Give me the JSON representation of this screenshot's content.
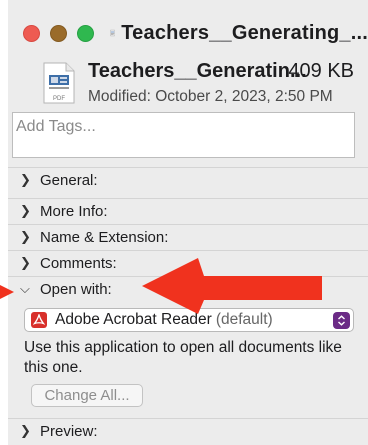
{
  "window": {
    "title": "Teachers__Generating_..."
  },
  "header": {
    "file_name": "Teachers__Generatin...",
    "file_size": "409 KB",
    "modified": "Modified: October 2, 2023, 2:50 PM",
    "icon_badge": "PDF"
  },
  "tags": {
    "placeholder": "Add Tags..."
  },
  "sections": {
    "general": "General:",
    "more_info": "More Info:",
    "name_extension": "Name & Extension:",
    "comments": "Comments:",
    "open_with": "Open with:",
    "preview": "Preview:"
  },
  "open_with": {
    "app_name": "Adobe Acrobat Reader",
    "default_label": "(default)",
    "description": "Use this application to open all documents like this one.",
    "change_all": "Change All..."
  },
  "colors": {
    "annotation_arrow": "#f0321e",
    "stepper_accent": "#6b2b86"
  }
}
